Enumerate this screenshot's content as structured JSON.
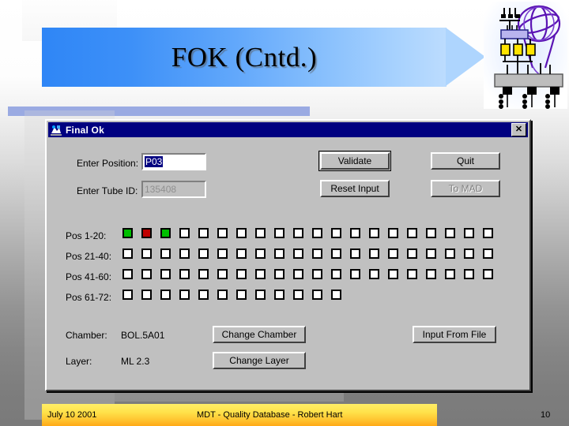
{
  "slide": {
    "title": "FOK (Cntd.)",
    "logo_name": "atlas-experiment-logo"
  },
  "dialog": {
    "title": "Final Ok",
    "close_label": "✕",
    "fields": {
      "position_label": "Enter Position:",
      "position_value": "P03",
      "tube_label": "Enter Tube ID:",
      "tube_value": "135408"
    },
    "buttons": {
      "validate": "Validate",
      "quit": "Quit",
      "reset_input": "Reset Input",
      "to_mad": "To MAD",
      "change_chamber": "Change Chamber",
      "change_layer": "Change Layer",
      "input_from_file": "Input From File"
    },
    "rows": [
      {
        "label": "Pos  1-20:",
        "count": 20,
        "states": [
          "green",
          "red",
          "green",
          "white",
          "white",
          "white",
          "white",
          "white",
          "white",
          "white",
          "white",
          "white",
          "white",
          "white",
          "white",
          "white",
          "white",
          "white",
          "white",
          "white"
        ]
      },
      {
        "label": "Pos 21-40:",
        "count": 20,
        "states": [
          "white",
          "white",
          "white",
          "white",
          "white",
          "white",
          "white",
          "white",
          "white",
          "white",
          "white",
          "white",
          "white",
          "white",
          "white",
          "white",
          "white",
          "white",
          "white",
          "white"
        ]
      },
      {
        "label": "Pos 41-60:",
        "count": 20,
        "states": [
          "white",
          "white",
          "white",
          "white",
          "white",
          "white",
          "white",
          "white",
          "white",
          "white",
          "white",
          "white",
          "white",
          "white",
          "white",
          "white",
          "white",
          "white",
          "white",
          "white"
        ]
      },
      {
        "label": "Pos 61-72:",
        "count": 12,
        "states": [
          "white",
          "white",
          "white",
          "white",
          "white",
          "white",
          "white",
          "white",
          "white",
          "white",
          "white",
          "white"
        ]
      }
    ],
    "info": {
      "chamber_label": "Chamber:",
      "chamber_value": "BOL.5A01",
      "layer_label": "Layer:",
      "layer_value": "ML 2.3"
    }
  },
  "footer": {
    "date": "July 10 2001",
    "center": "MDT - Quality Database - Robert Hart",
    "page": "10"
  },
  "colors": {
    "banner_blue": "#3d90f8",
    "titlebar_navy": "#000080",
    "dialog_face": "#c0c0c0",
    "ok_green": "#00c000",
    "fail_red": "#c00000",
    "footer_yellow": "#ffe24a",
    "strip_blue": "#9aaae2"
  }
}
